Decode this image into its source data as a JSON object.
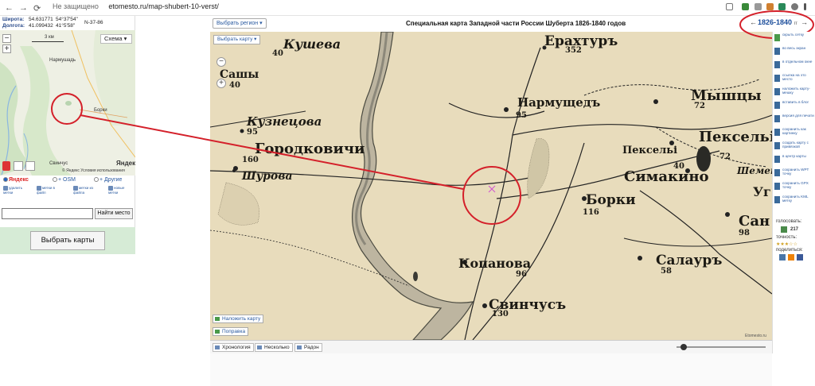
{
  "browser": {
    "back_icon": "←",
    "forward_icon": "→",
    "reload_icon": "⟳",
    "security_label": "Не защищено",
    "url": "etomesto.ru/map-shubert-10-verst/"
  },
  "left_panel": {
    "lat_label": "Широта:",
    "lat_value1": "54.631771",
    "lat_value2": "54°37'54\"",
    "lon_label": "Долгота:",
    "lon_value1": "41.099432",
    "lon_value2": "41°5'58\"",
    "sheet": "N-37-86",
    "zoom_in": "+",
    "zoom_out": "−",
    "scale_label": "3 км",
    "scheme_label": "Схема ▾",
    "minimap_labels": {
      "narmushad": "Нармушадь",
      "borki": "Борки",
      "svinchus": "Свинчус"
    },
    "yandex_logo": "Яндекс",
    "yandex_terms": "© Яндекс  Условия использования",
    "providers": {
      "yandex": "Яндекс",
      "osm": "+ OSM",
      "other": "+ Другие"
    },
    "tools": [
      {
        "label": "удалить метки"
      },
      {
        "label": "метки в файл"
      },
      {
        "label": "метки из файла"
      },
      {
        "label": "новые метки"
      }
    ],
    "search_placeholder": "",
    "search_button": "Найти место",
    "choose_maps_button": "Выбрать карты"
  },
  "map_header": {
    "region_button": "Выбрать регион ▾",
    "title": "Специальная карта Западной части России Шуберта 1826-1840 годов",
    "years": "1826-1840",
    "years_suffix": "гг",
    "prev_arrow": "←",
    "next_arrow": "→"
  },
  "map": {
    "map_type_button": "Выбрать карту ▾",
    "zoom_in": "+",
    "zoom_out": "−",
    "labels": {
      "kusheva": "Кушева",
      "kusheva_num": "40",
      "sashi": "Сашы",
      "sashi_num": "40",
      "kuznetsova": "Кузнецова",
      "kuznetsova_num": "95",
      "gorodkovichi": "Городковичи",
      "gorodkovichi_num": "160",
      "shurova": "Шурова",
      "erakhtur": "Ерахтуръ",
      "erakhtur_num": "352",
      "narmushad": "Нармущедъ",
      "narmushad_num": "95",
      "myshtsy": "Мышцы",
      "myshtsy_num": "72",
      "peksely": "Пексельі",
      "peksely_num": "72",
      "peksely2": "Пексельі",
      "simakino": "Симакино",
      "simakino_num": "40",
      "shemen": "Шемен",
      "borki": "Борки",
      "borki_num": "116",
      "san": "Сан",
      "san_num": "98",
      "salaur": "Салауръ",
      "salaur_num": "58",
      "kopanova": "Копанова",
      "kopanova_num": "96",
      "svinchus": "Свинчусъ",
      "svinchus_num": "130",
      "ug": "Уг"
    },
    "overlay_button": "Наложить карту",
    "correction_button": "Поправка",
    "copyright": "Etomesto.ru"
  },
  "bottom_bar": {
    "chronology": "Хронология",
    "several": "Несколько",
    "radon": "Радон"
  },
  "right_bar": {
    "items": [
      "скрыть сетку",
      "во весь экран",
      "в отдельном окне",
      "ссылка на это место",
      "наложить карту-мешку",
      "вставить в блог",
      "версия для печати",
      "сохранить как картинку",
      "создать карту с привязкой",
      "в центр карты",
      "сохранить WPT точку",
      "сохранить GPX точку",
      "сохранить KML метку"
    ],
    "vote_label": "голосовать:",
    "vote_count": "217",
    "accuracy_label": "точность:",
    "accuracy_stars": "★★★☆☆",
    "share_label": "поделиться:"
  },
  "colors": {
    "map_paper": "#e8dcbc",
    "annotation_red": "#d4202a",
    "link_blue": "#2a5aa0"
  }
}
